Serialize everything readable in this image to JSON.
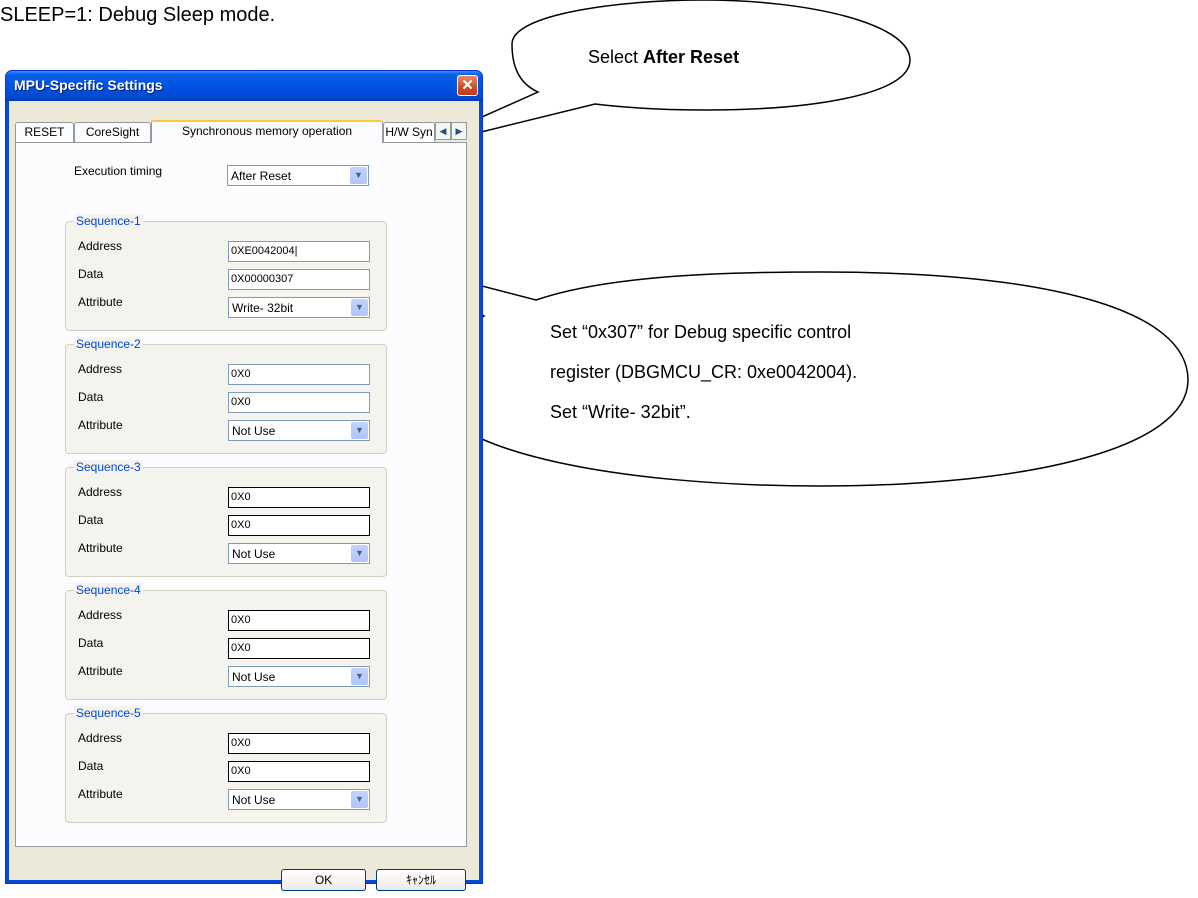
{
  "document": {
    "top_text": "SLEEP=1: Debug Sleep mode."
  },
  "window": {
    "title": "MPU-Specific Settings",
    "close_glyph": "✕",
    "tabs": [
      {
        "label": "RESET"
      },
      {
        "label": "CoreSight"
      },
      {
        "label": "Synchronous memory operation"
      },
      {
        "label": "H/W Syn"
      }
    ],
    "tab_scroll_left": "◀",
    "tab_scroll_right": "▶",
    "execution_timing_label": "Execution timing",
    "execution_timing_value": "After Reset",
    "field_labels": {
      "address": "Address",
      "data": "Data",
      "attribute": "Attribute"
    },
    "dropdown_arrow": "▼",
    "sequences": [
      {
        "title": "Sequence-1",
        "address": "0XE0042004|",
        "data": "0X00000307",
        "attribute": "Write- 32bit"
      },
      {
        "title": "Sequence-2",
        "address": "0X0",
        "data": "0X0",
        "attribute": "Not Use"
      },
      {
        "title": "Sequence-3",
        "address": "0X0",
        "data": "0X0",
        "attribute": "Not Use"
      },
      {
        "title": "Sequence-4",
        "address": "0X0",
        "data": "0X0",
        "attribute": "Not Use"
      },
      {
        "title": "Sequence-5",
        "address": "0X0",
        "data": "0X0",
        "attribute": "Not Use"
      }
    ],
    "ok_label": "OK",
    "cancel_label": "ｷｬﾝｾﾙ"
  },
  "callouts": {
    "select_prefix": "Select ",
    "select_bold": "After Reset",
    "set_line1": "Set  “0x307”  for  Debug  specific  control",
    "set_line2": "register    (DBGMCU_CR: 0xe0042004).",
    "set_line3": "Set “Write- 32bit”."
  }
}
